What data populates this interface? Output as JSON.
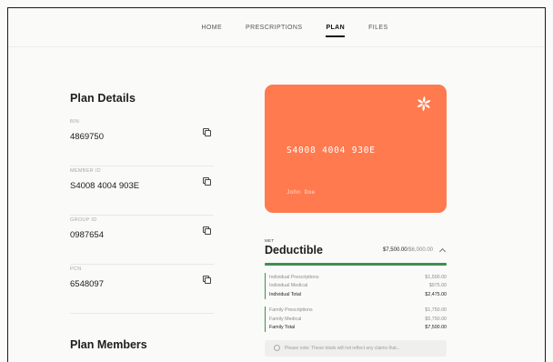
{
  "nav": {
    "items": [
      {
        "label": "HOME",
        "active": false
      },
      {
        "label": "PRESCRIPTIONS",
        "active": false
      },
      {
        "label": "PLAN",
        "active": true
      },
      {
        "label": "FILES",
        "active": false
      }
    ]
  },
  "plan_details": {
    "title": "Plan Details",
    "fields": [
      {
        "label": "BIN",
        "value": "4869750",
        "icon": "copy-icon"
      },
      {
        "label": "MEMBER ID",
        "value": "S4008 4004 903E",
        "icon": "copy-icon"
      },
      {
        "label": "GROUP ID",
        "value": "0987654",
        "icon": "copy-icon"
      },
      {
        "label": "PCN",
        "value": "6548097",
        "icon": "copy-icon"
      }
    ]
  },
  "plan_members": {
    "title": "Plan Members"
  },
  "card": {
    "number": "S4008 4004 930E",
    "holder": "John Doe",
    "color": "#ff7a4e",
    "logo_icon": "pinwheel-logo-icon"
  },
  "deductible": {
    "status": "MET",
    "title": "Deductible",
    "amount": "$7,500.00",
    "limit": "/$6,000.00",
    "progress_fraction": 1.0,
    "accent_color": "#3f8f52",
    "individual": [
      {
        "label": "Individual Prescriptions",
        "value": "$1,500.00",
        "total": false
      },
      {
        "label": "Individual Medical",
        "value": "$975.00",
        "total": false
      },
      {
        "label": "Individual Total",
        "value": "$2,475.00",
        "total": true
      }
    ],
    "family": [
      {
        "label": "Family Prescriptions",
        "value": "$1,750.00",
        "total": false
      },
      {
        "label": "Family Medical",
        "value": "$5,750.00",
        "total": false
      },
      {
        "label": "Family Total",
        "value": "$7,500.00",
        "total": true
      }
    ],
    "note": "Please note: These totals will not reflect any claims that..."
  }
}
